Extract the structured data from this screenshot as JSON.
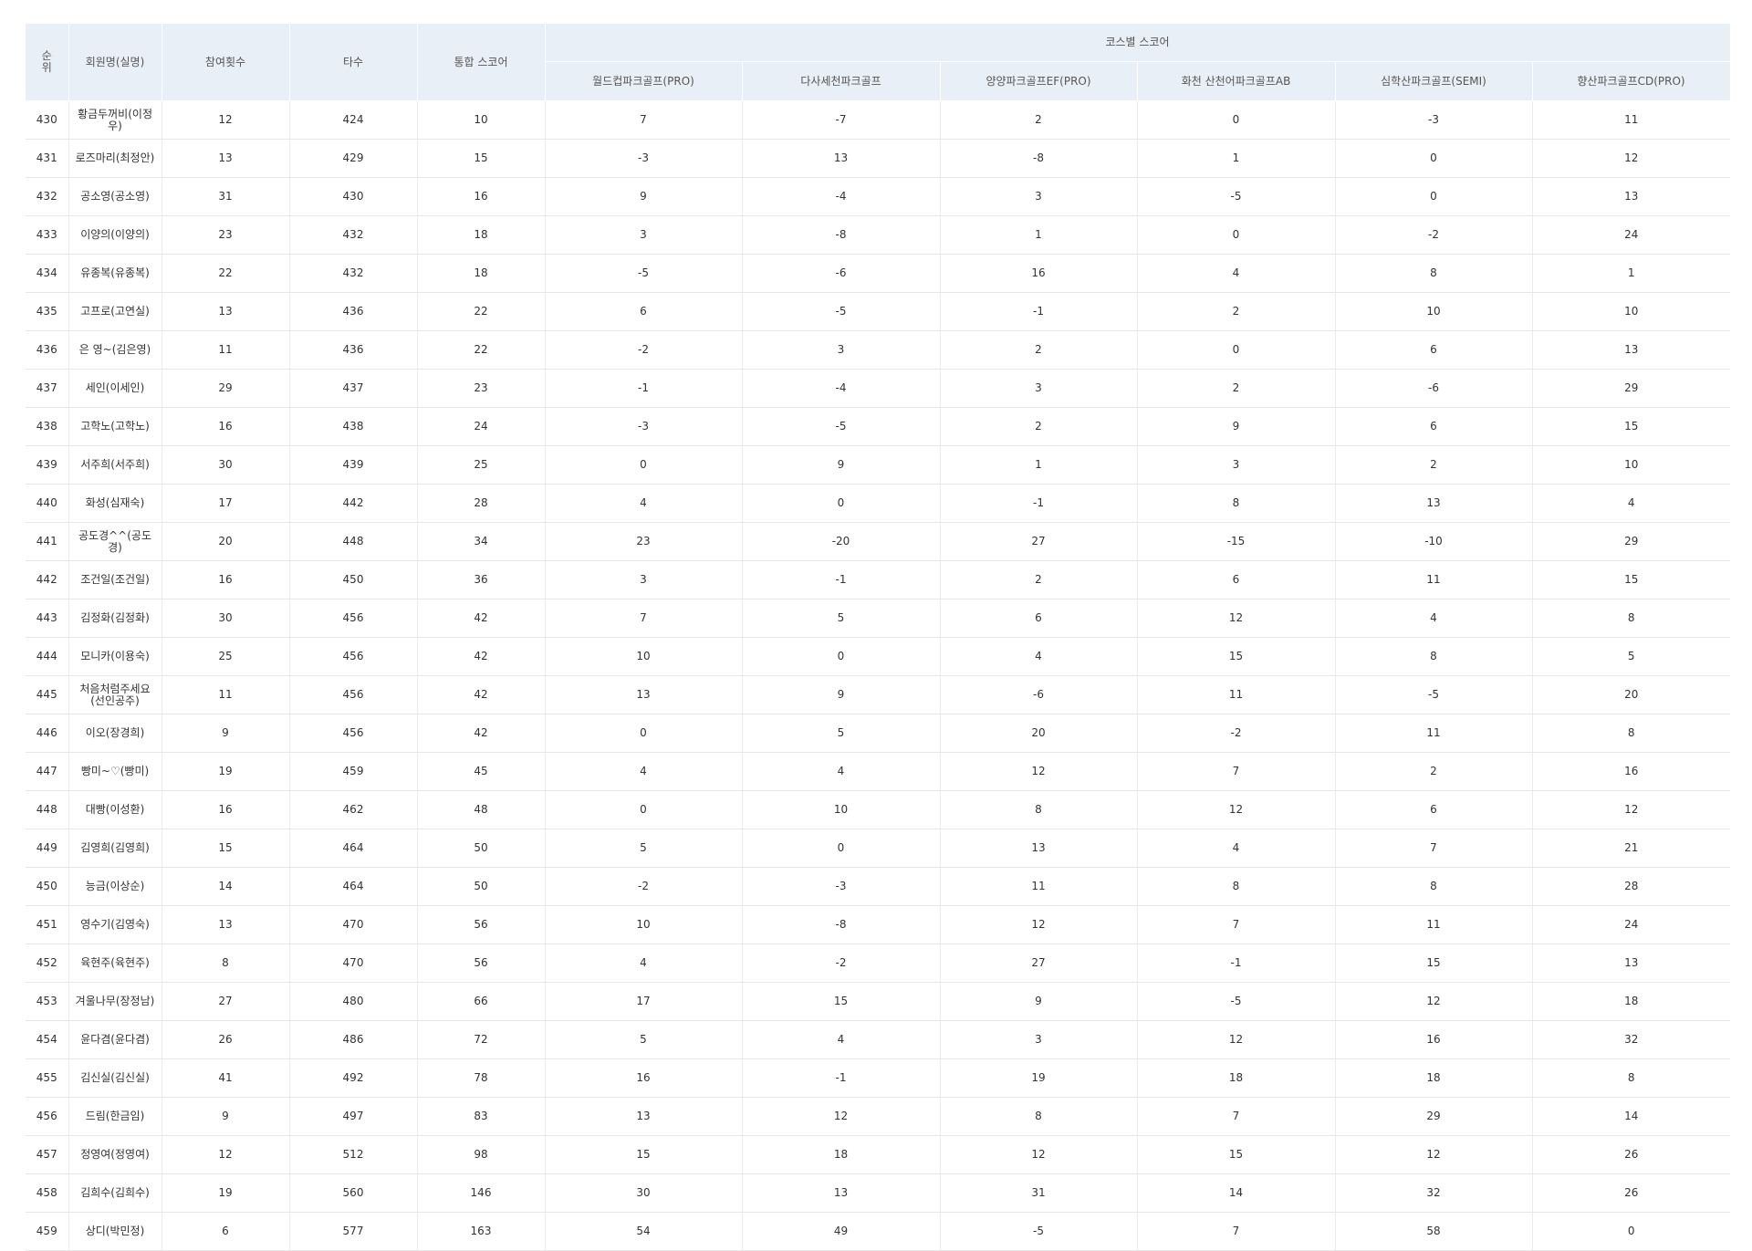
{
  "header": {
    "rank": "순\n위",
    "member": "회원명(실명)",
    "participation": "참여횟수",
    "strokes": "타수",
    "total": "통합 스코어",
    "course_group": "코스별 스코어",
    "courses": [
      "월드컵파크골프(PRO)",
      "다사세천파크골프",
      "양양파크골프EF(PRO)",
      "화천 산천어파크골프AB",
      "심학산파크골프(SEMI)",
      "향산파크골프CD(PRO)"
    ]
  },
  "rows": [
    {
      "rank": "430",
      "name": "황금두꺼비(이정우)",
      "count": "12",
      "strokes": "424",
      "total": "10",
      "s": [
        "7",
        "-7",
        "2",
        "0",
        "-3",
        "11"
      ]
    },
    {
      "rank": "431",
      "name": "로즈마리(최정안)",
      "count": "13",
      "strokes": "429",
      "total": "15",
      "s": [
        "-3",
        "13",
        "-8",
        "1",
        "0",
        "12"
      ]
    },
    {
      "rank": "432",
      "name": "공소영(공소영)",
      "count": "31",
      "strokes": "430",
      "total": "16",
      "s": [
        "9",
        "-4",
        "3",
        "-5",
        "0",
        "13"
      ]
    },
    {
      "rank": "433",
      "name": "이양의(이양의)",
      "count": "23",
      "strokes": "432",
      "total": "18",
      "s": [
        "3",
        "-8",
        "1",
        "0",
        "-2",
        "24"
      ]
    },
    {
      "rank": "434",
      "name": "유종복(유종복)",
      "count": "22",
      "strokes": "432",
      "total": "18",
      "s": [
        "-5",
        "-6",
        "16",
        "4",
        "8",
        "1"
      ]
    },
    {
      "rank": "435",
      "name": "고프로(고연실)",
      "count": "13",
      "strokes": "436",
      "total": "22",
      "s": [
        "6",
        "-5",
        "-1",
        "2",
        "10",
        "10"
      ]
    },
    {
      "rank": "436",
      "name": "은 영~(김은영)",
      "count": "11",
      "strokes": "436",
      "total": "22",
      "s": [
        "-2",
        "3",
        "2",
        "0",
        "6",
        "13"
      ]
    },
    {
      "rank": "437",
      "name": "세인(이세인)",
      "count": "29",
      "strokes": "437",
      "total": "23",
      "s": [
        "-1",
        "-4",
        "3",
        "2",
        "-6",
        "29"
      ]
    },
    {
      "rank": "438",
      "name": "고학노(고학노)",
      "count": "16",
      "strokes": "438",
      "total": "24",
      "s": [
        "-3",
        "-5",
        "2",
        "9",
        "6",
        "15"
      ]
    },
    {
      "rank": "439",
      "name": "서주희(서주희)",
      "count": "30",
      "strokes": "439",
      "total": "25",
      "s": [
        "0",
        "9",
        "1",
        "3",
        "2",
        "10"
      ]
    },
    {
      "rank": "440",
      "name": "화성(심재숙)",
      "count": "17",
      "strokes": "442",
      "total": "28",
      "s": [
        "4",
        "0",
        "-1",
        "8",
        "13",
        "4"
      ]
    },
    {
      "rank": "441",
      "name": "공도경^^(공도경)",
      "count": "20",
      "strokes": "448",
      "total": "34",
      "s": [
        "23",
        "-20",
        "27",
        "-15",
        "-10",
        "29"
      ]
    },
    {
      "rank": "442",
      "name": "조건일(조건일)",
      "count": "16",
      "strokes": "450",
      "total": "36",
      "s": [
        "3",
        "-1",
        "2",
        "6",
        "11",
        "15"
      ]
    },
    {
      "rank": "443",
      "name": "김정화(김정화)",
      "count": "30",
      "strokes": "456",
      "total": "42",
      "s": [
        "7",
        "5",
        "6",
        "12",
        "4",
        "8"
      ]
    },
    {
      "rank": "444",
      "name": "모니카(이용숙)",
      "count": "25",
      "strokes": "456",
      "total": "42",
      "s": [
        "10",
        "0",
        "4",
        "15",
        "8",
        "5"
      ]
    },
    {
      "rank": "445",
      "name": "처음처럼주세요(선인공주)",
      "count": "11",
      "strokes": "456",
      "total": "42",
      "s": [
        "13",
        "9",
        "-6",
        "11",
        "-5",
        "20"
      ]
    },
    {
      "rank": "446",
      "name": "이오(장경희)",
      "count": "9",
      "strokes": "456",
      "total": "42",
      "s": [
        "0",
        "5",
        "20",
        "-2",
        "11",
        "8"
      ]
    },
    {
      "rank": "447",
      "name": "빵미~♡(빵미)",
      "count": "19",
      "strokes": "459",
      "total": "45",
      "s": [
        "4",
        "4",
        "12",
        "7",
        "2",
        "16"
      ]
    },
    {
      "rank": "448",
      "name": "대빵(이성환)",
      "count": "16",
      "strokes": "462",
      "total": "48",
      "s": [
        "0",
        "10",
        "8",
        "12",
        "6",
        "12"
      ]
    },
    {
      "rank": "449",
      "name": "김영희(김영희)",
      "count": "15",
      "strokes": "464",
      "total": "50",
      "s": [
        "5",
        "0",
        "13",
        "4",
        "7",
        "21"
      ]
    },
    {
      "rank": "450",
      "name": "능금(이상순)",
      "count": "14",
      "strokes": "464",
      "total": "50",
      "s": [
        "-2",
        "-3",
        "11",
        "8",
        "8",
        "28"
      ]
    },
    {
      "rank": "451",
      "name": "영수기(김영숙)",
      "count": "13",
      "strokes": "470",
      "total": "56",
      "s": [
        "10",
        "-8",
        "12",
        "7",
        "11",
        "24"
      ]
    },
    {
      "rank": "452",
      "name": "육현주(육현주)",
      "count": "8",
      "strokes": "470",
      "total": "56",
      "s": [
        "4",
        "-2",
        "27",
        "-1",
        "15",
        "13"
      ]
    },
    {
      "rank": "453",
      "name": "겨울나무(장정남)",
      "count": "27",
      "strokes": "480",
      "total": "66",
      "s": [
        "17",
        "15",
        "9",
        "-5",
        "12",
        "18"
      ]
    },
    {
      "rank": "454",
      "name": "윤다겸(윤다겸)",
      "count": "26",
      "strokes": "486",
      "total": "72",
      "s": [
        "5",
        "4",
        "3",
        "12",
        "16",
        "32"
      ]
    },
    {
      "rank": "455",
      "name": "김신실(김신실)",
      "count": "41",
      "strokes": "492",
      "total": "78",
      "s": [
        "16",
        "-1",
        "19",
        "18",
        "18",
        "8"
      ]
    },
    {
      "rank": "456",
      "name": "드림(한금임)",
      "count": "9",
      "strokes": "497",
      "total": "83",
      "s": [
        "13",
        "12",
        "8",
        "7",
        "29",
        "14"
      ]
    },
    {
      "rank": "457",
      "name": "정영여(정영여)",
      "count": "12",
      "strokes": "512",
      "total": "98",
      "s": [
        "15",
        "18",
        "12",
        "15",
        "12",
        "26"
      ]
    },
    {
      "rank": "458",
      "name": "김희수(김희수)",
      "count": "19",
      "strokes": "560",
      "total": "146",
      "s": [
        "30",
        "13",
        "31",
        "14",
        "32",
        "26"
      ]
    },
    {
      "rank": "459",
      "name": "상디(박민정)",
      "count": "6",
      "strokes": "577",
      "total": "163",
      "s": [
        "54",
        "49",
        "-5",
        "7",
        "58",
        "0"
      ]
    }
  ]
}
